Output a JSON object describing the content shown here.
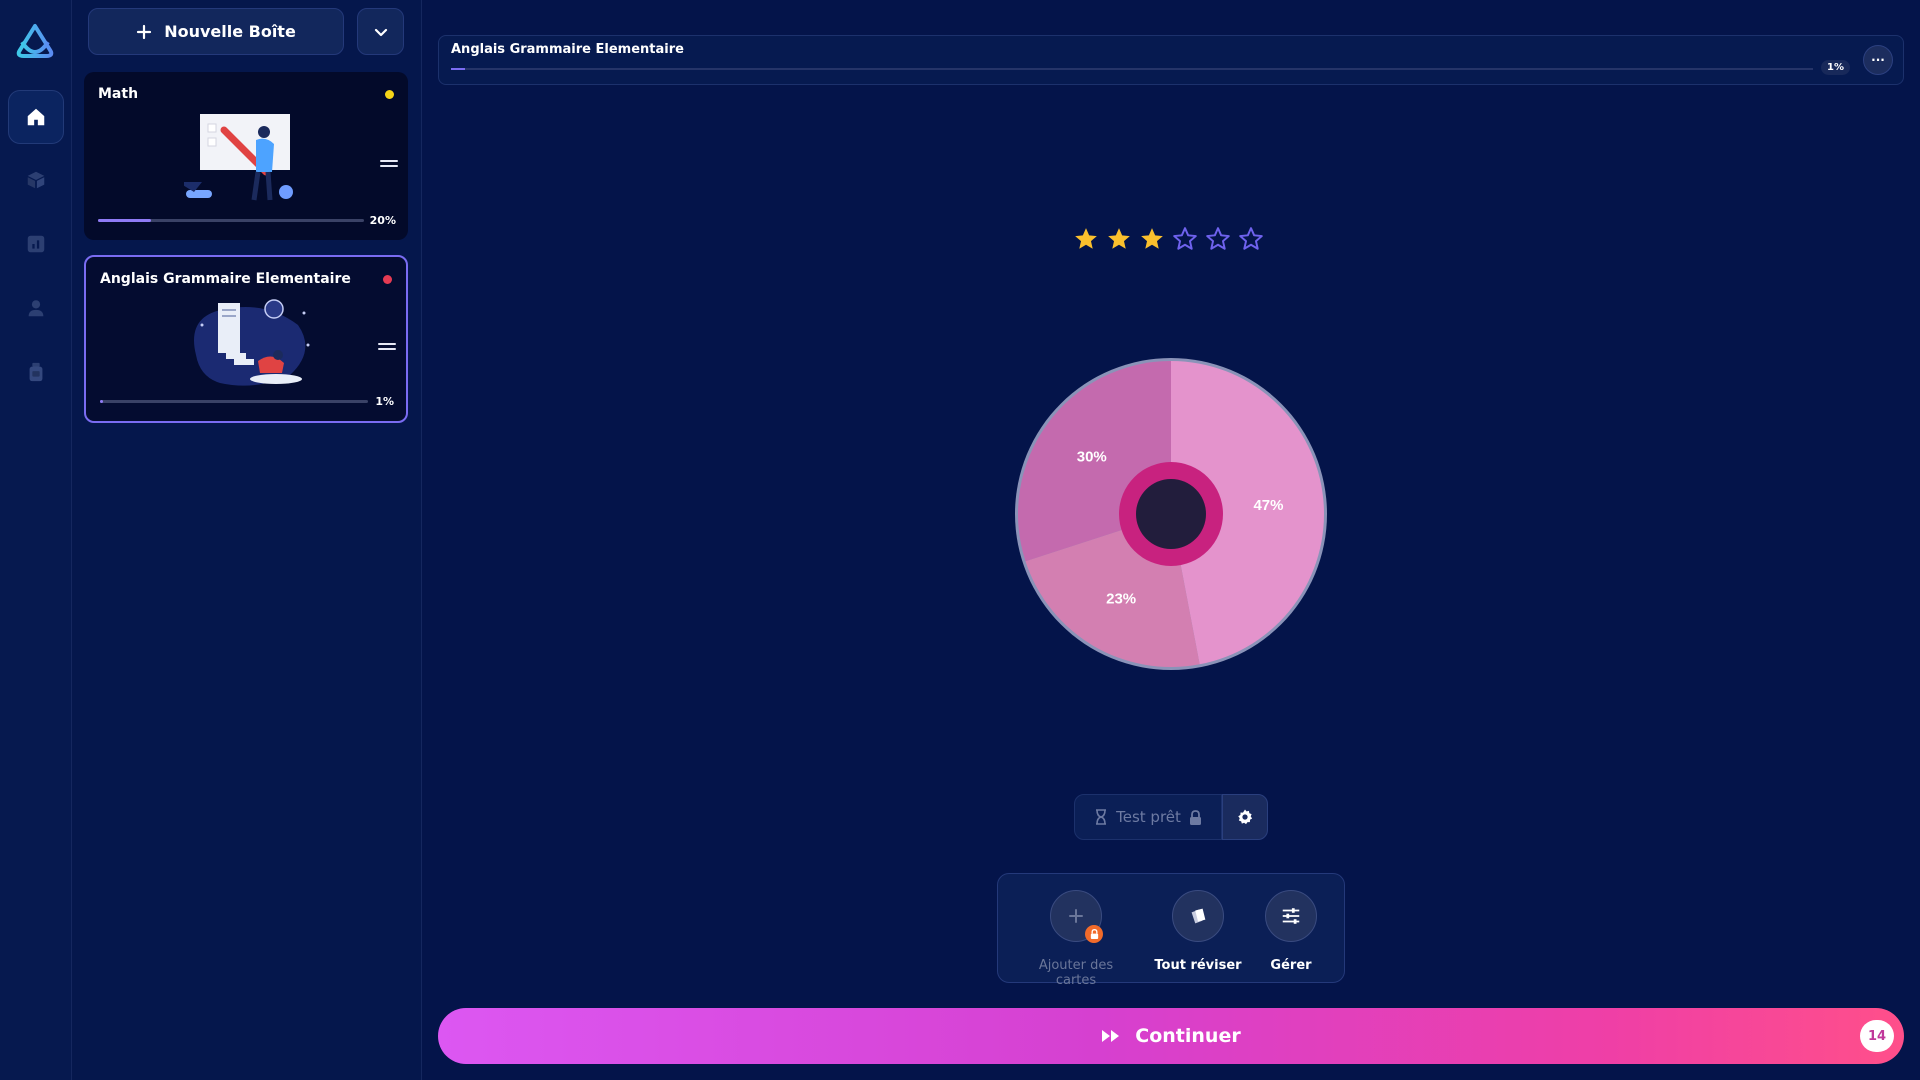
{
  "sidebar": {
    "new_box_label": "Nouvelle Boîte",
    "decks": [
      {
        "title": "Math",
        "progress_label": "20%",
        "progress": 0.2,
        "dot_color": "#f5d418"
      },
      {
        "title": "Anglais Grammaire Elementaire",
        "progress_label": "1%",
        "progress": 0.01,
        "dot_color": "#e53b53"
      }
    ]
  },
  "rail": {
    "items": [
      "home-icon",
      "box-icon",
      "chart-icon",
      "user-icon",
      "bottle-icon"
    ]
  },
  "header": {
    "deck_title": "Anglais Grammaire Elementaire",
    "progress_label": "1%",
    "progress": 0.01,
    "more_label": "···"
  },
  "rating": {
    "filled": 3,
    "total": 6
  },
  "chart_data": {
    "type": "pie",
    "categories": [
      "",
      "",
      ""
    ],
    "values": [
      47,
      23,
      30
    ],
    "labels": [
      "47%",
      "23%",
      "30%"
    ],
    "colors": [
      "#e493cc",
      "#d37fb1",
      "#c46aae"
    ]
  },
  "test": {
    "label": "Test prêt"
  },
  "actions": [
    {
      "label": "Ajouter des cartes",
      "icon": "plus-icon",
      "disabled": true
    },
    {
      "label": "Tout réviser",
      "icon": "cards-icon",
      "disabled": false
    },
    {
      "label": "Gérer",
      "icon": "sliders-icon",
      "disabled": false
    }
  ],
  "continue": {
    "label": "Continuer",
    "count": "14"
  },
  "colors": {
    "background": "#04144a",
    "accent": "#7a6cf2",
    "star": "#fbc02d",
    "continue_start": "#dc57f2",
    "continue_end": "#ff4f8a"
  }
}
